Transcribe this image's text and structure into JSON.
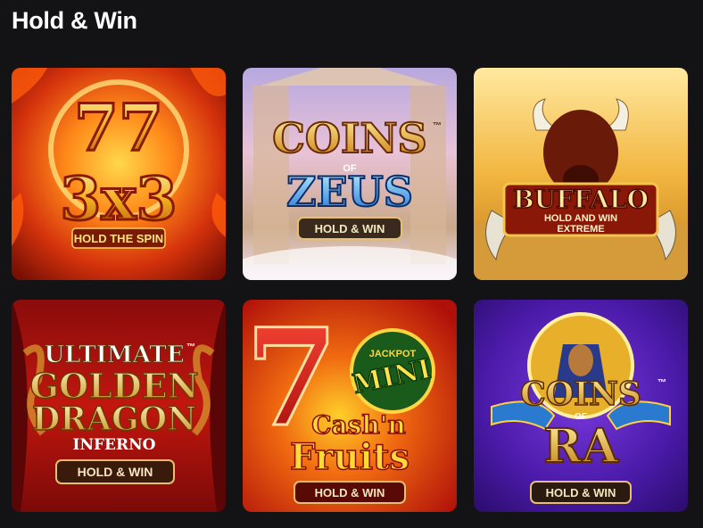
{
  "section": {
    "title": "Hold & Win"
  },
  "games": [
    {
      "name": "777 3x3 Hold the Spin",
      "art": {
        "line1": "77",
        "line2": "3x3",
        "badge": "HOLD THE SPIN"
      }
    },
    {
      "name": "Coins of Zeus Hold & Win",
      "art": {
        "line1": "COINS",
        "of": "OF",
        "line2": "ZEUS",
        "tm": "™",
        "badge": "HOLD & WIN"
      }
    },
    {
      "name": "Buffalo Hold and Win Extreme",
      "art": {
        "line1": "BUFFALO",
        "line2": "HOLD AND WIN",
        "line3": "EXTREME"
      }
    },
    {
      "name": "Ultimate Golden Dragon Inferno Hold & Win",
      "art": {
        "line1": "ULTIMATE",
        "line2": "GOLDEN",
        "line3": "DRAGON",
        "line4": "INFERNO",
        "tm": "™",
        "badge": "HOLD & WIN"
      }
    },
    {
      "name": "Cash'n Fruits Hold & Win",
      "art": {
        "seven": "7",
        "jackpot": "JACKPOT",
        "mini": "MINI",
        "line1": "Cash'n",
        "line2": "Fruits",
        "badge": "HOLD & WIN"
      }
    },
    {
      "name": "Coins of Ra Hold & Win",
      "art": {
        "line1": "COINS",
        "of": "OF",
        "line2": "RA",
        "tm": "™",
        "badge": "HOLD & WIN"
      }
    }
  ]
}
